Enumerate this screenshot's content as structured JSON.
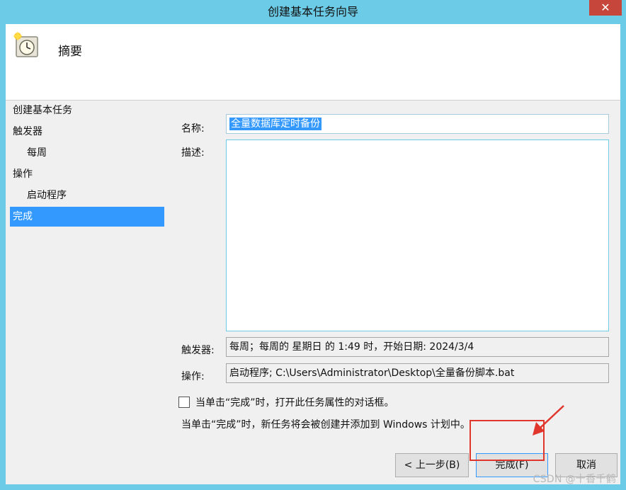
{
  "window": {
    "title": "创建基本任务向导",
    "close_glyph": "✕"
  },
  "header": {
    "title": "摘要",
    "icon": "scheduled-task-clock-icon"
  },
  "steps": [
    {
      "label": "创建基本任务"
    },
    {
      "label": "触发器"
    },
    {
      "label": "每周"
    },
    {
      "label": "操作"
    },
    {
      "label": "启动程序"
    },
    {
      "label": "完成"
    }
  ],
  "fields": {
    "name_label": "名称:",
    "name_value": "全量数据库定时备份",
    "description_label": "描述:",
    "description_value": "",
    "trigger_label": "触发器:",
    "trigger_value": "每周；每周的 星期日 的 1:49 时，开始日期: 2024/3/4",
    "action_label": "操作:",
    "action_value": "启动程序; C:\\Users\\Administrator\\Desktop\\全量备份脚本.bat"
  },
  "options": {
    "open_properties_label": "当单击“完成”时，打开此任务属性的对话框。",
    "open_properties_checked": false,
    "info_text": "当单击“完成”时，新任务将会被创建并添加到 Windows 计划中。"
  },
  "buttons": {
    "back": "< 上一步(B)",
    "finish": "完成(F)",
    "cancel": "取消"
  },
  "watermark": "CSDN @十香千鹤",
  "colors": {
    "title_bar": "#6ccbe6",
    "selection": "#3399ff",
    "annotation_red": "#e0362c",
    "close_button": "#c7463b"
  }
}
